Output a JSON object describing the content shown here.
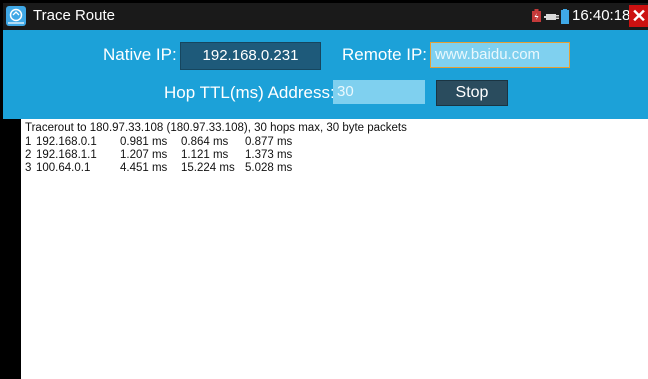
{
  "window": {
    "title": "Trace Route",
    "time": "16:40:18",
    "status_icons": [
      "battery-charge-icon",
      "network-plug-icon",
      "battery-level-icon"
    ]
  },
  "form": {
    "native_ip_label": "Native IP:",
    "native_ip_value": "192.168.0.231",
    "remote_ip_label": "Remote IP:",
    "remote_ip_value": "www.baidu.com",
    "hop_ttl_label": "Hop TTL(ms) Address:",
    "hop_ttl_value": "30",
    "stop_label": "Stop"
  },
  "output": {
    "header": "Tracerout to 180.97.33.108 (180.97.33.108), 30 hops max, 30 byte packets",
    "hops": [
      {
        "n": "1",
        "address": "192.168.0.1",
        "t1": "0.981 ms",
        "t2": "0.864 ms",
        "t3": "0.877 ms"
      },
      {
        "n": "2",
        "address": "192.168.1.1",
        "t1": "1.207 ms",
        "t2": "1.121 ms",
        "t3": "1.373 ms"
      },
      {
        "n": "3",
        "address": "100.64.0.1",
        "t1": "4.451 ms",
        "t2": "15.224 ms",
        "t3": "5.028 ms"
      }
    ]
  }
}
